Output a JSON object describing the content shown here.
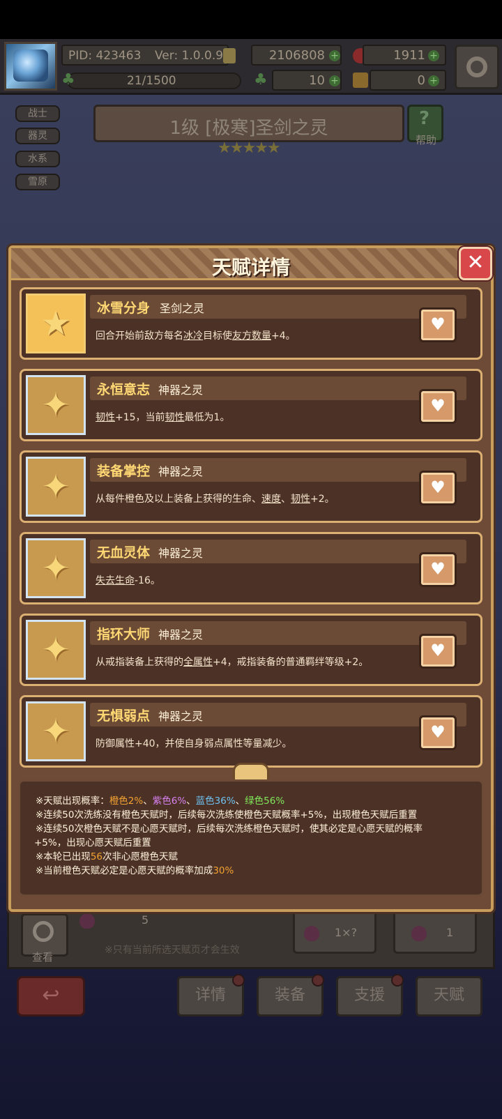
{
  "hud": {
    "pid": "PID: 423463",
    "version": "Ver: 1.0.0.9",
    "gold": "2106808",
    "gems": "1911",
    "exp": "21/1500",
    "clover": "10",
    "keys": "0"
  },
  "tags": [
    "战士",
    "器灵",
    "水系",
    "雪原"
  ],
  "character": {
    "title": "1级  [极寒]圣剑之灵",
    "stars": "★★★★★",
    "help_label": "帮助"
  },
  "modal": {
    "title": "天赋详情",
    "close": "✕",
    "talents": [
      {
        "name": "冰雪分身",
        "source": "圣剑之灵",
        "desc_parts": [
          "回合开始前敌方每名",
          "冰冷",
          "目标使",
          "友方数量",
          "+4。"
        ]
      },
      {
        "name": "永恒意志",
        "source": "神器之灵",
        "desc_parts": [
          "韧性",
          "+15，当前",
          "韧性",
          "最低为1。"
        ]
      },
      {
        "name": "装备掌控",
        "source": "神器之灵",
        "desc_parts": [
          "从每件橙色及以上装备上获得的生命、",
          "速度",
          "、",
          "韧性",
          "+2。"
        ]
      },
      {
        "name": "无血灵体",
        "source": "神器之灵",
        "desc_parts": [
          "失去生命",
          "-16。"
        ]
      },
      {
        "name": "指环大师",
        "source": "神器之灵",
        "desc_parts": [
          "从戒指装备上获得的",
          "全属性",
          "+4，戒指装备的普通羁绊等级+2。"
        ]
      },
      {
        "name": "无惧弱点",
        "source": "神器之灵",
        "desc_parts": [
          "防御属性+40，并使自身弱点属性等量减少。"
        ]
      }
    ],
    "notes": {
      "line1_prefix": "※天赋出现概率：",
      "orange": "橙色2%",
      "sep1": "、",
      "purple": "紫色6%",
      "sep2": "、",
      "blue": "蓝色36%",
      "sep3": "、",
      "green": "绿色56%",
      "line2": "※连续50次洗练没有橙色天赋时，后续每次洗练使橙色天赋概率+5%，出现橙色天赋后重置",
      "line3": "※连续50次橙色天赋不是心愿天赋时，后续每次洗练橙色天赋时，使其必定是心愿天赋的概率",
      "line4": "+5%，出现心愿天赋后重置",
      "line5_prefix": "※本轮已出现",
      "line5_num": "56",
      "line5_suffix": "次非心愿橙色天赋",
      "line6_prefix": "※当前橙色天赋必定是心愿天赋的概率加成",
      "line6_num": "30%"
    }
  },
  "under": {
    "view_label": "查看",
    "pouch_count": "5",
    "note": "※只有当前所选天赋页才会生效",
    "card1_value": "1×?",
    "card2_value": "1"
  },
  "bottom_nav": {
    "back": "↩",
    "details": "详情",
    "equip": "装备",
    "support": "支援",
    "talent": "天赋"
  }
}
